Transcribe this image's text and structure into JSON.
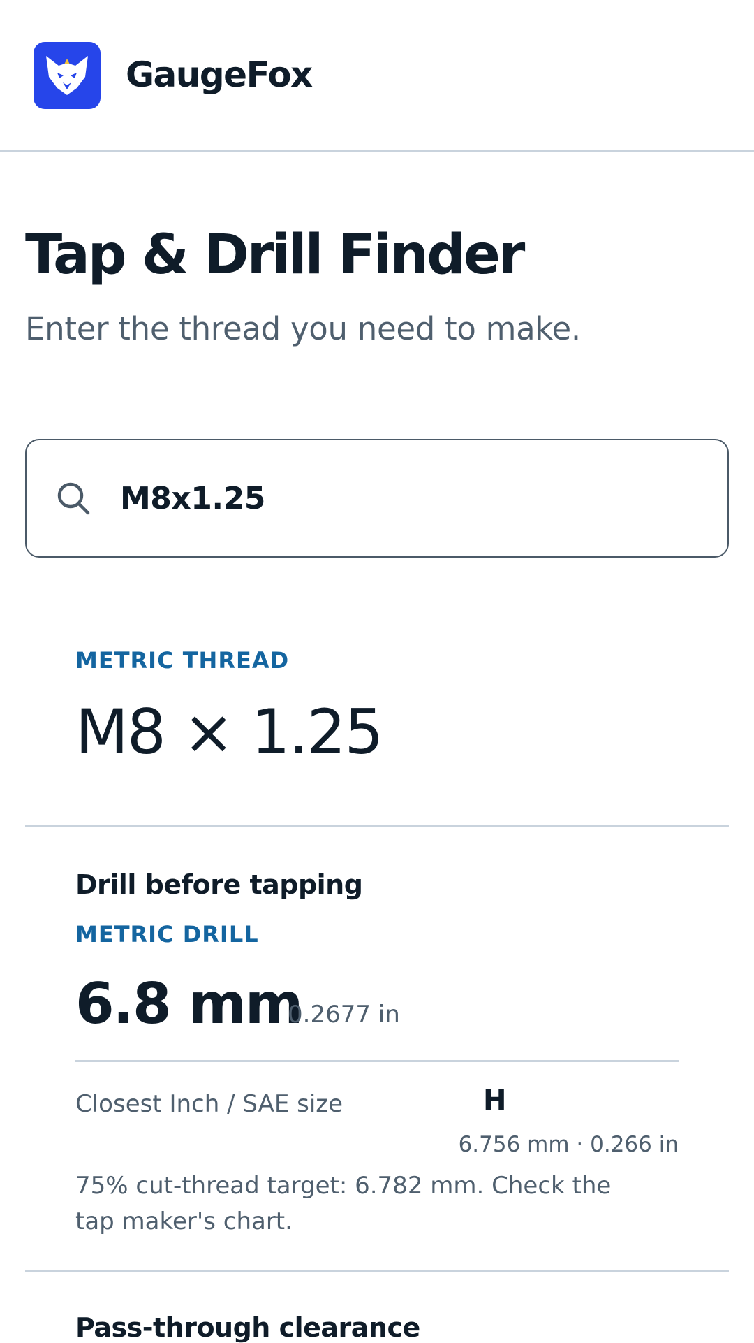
{
  "app": {
    "name": "GaugeFox",
    "icon": "fox-logo-icon",
    "brand_color": "#2645ea"
  },
  "page": {
    "title": "Tap & Drill Finder",
    "subtitle": "Enter the thread you need to make."
  },
  "search": {
    "icon": "search-icon",
    "value": "M8x1.25"
  },
  "result": {
    "thread_kicker": "METRIC THREAD",
    "thread_size": "M8 × 1.25",
    "drill": {
      "heading": "Drill before tapping",
      "kicker": "METRIC DRILL",
      "size": "6.8 mm",
      "inch": "0.2677 in",
      "sae_label": "Closest Inch / SAE size",
      "sae_value": "H",
      "sae_detail": "6.756 mm · 0.266 in",
      "note": "75% cut-thread target: 6.782 mm. Check the tap maker's chart."
    },
    "clearance": {
      "heading": "Pass-through clearance"
    }
  },
  "colors": {
    "accent": "#1465a0",
    "text": "#0f1c29",
    "muted": "#4f5f6e",
    "divider": "#c9d3dd"
  }
}
